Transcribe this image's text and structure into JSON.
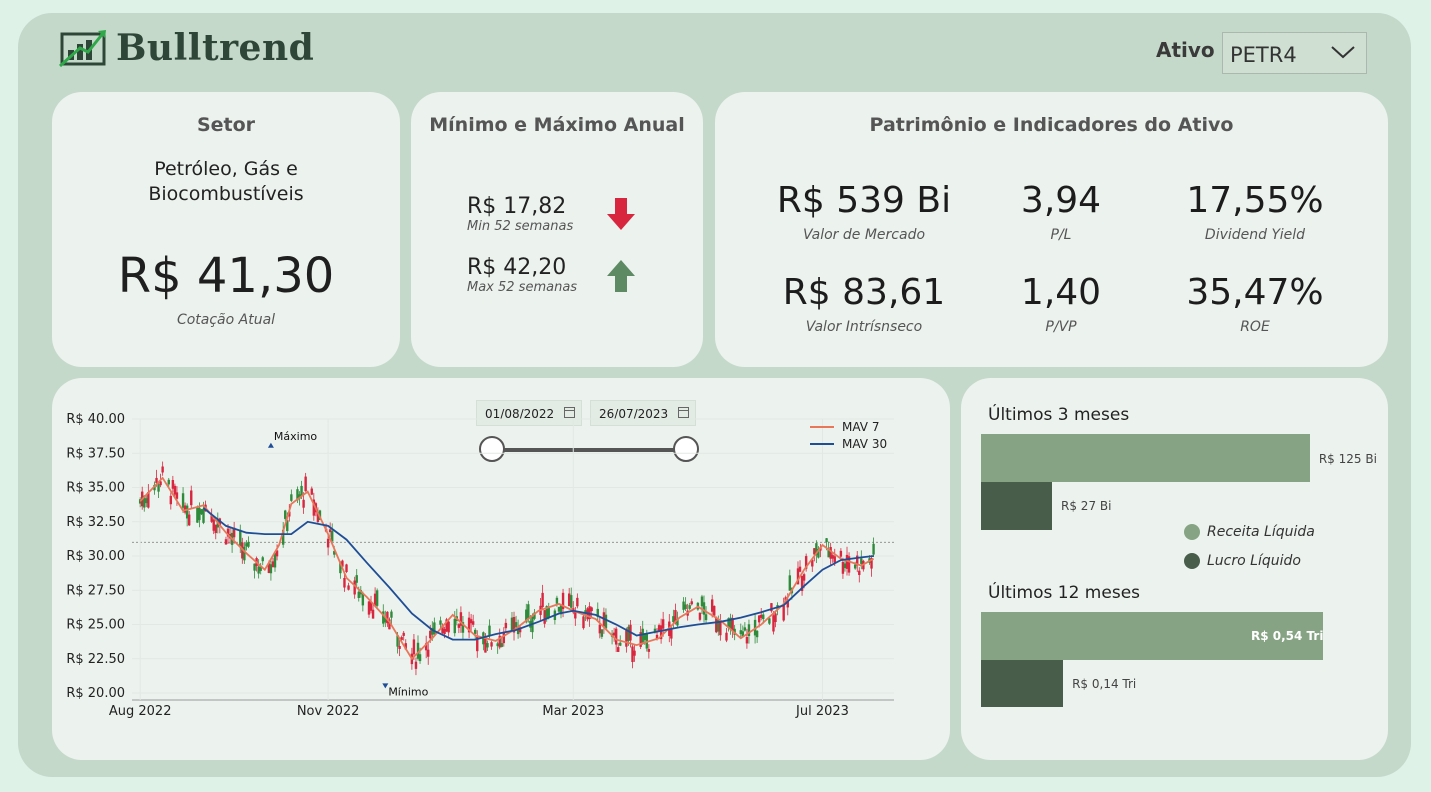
{
  "app": {
    "brand": "Bulltrend"
  },
  "asset_filter": {
    "label": "Ativo",
    "selected": "PETR4"
  },
  "sector_card": {
    "title": "Setor",
    "sector_line1": "Petróleo, Gás e",
    "sector_line2": "Biocombustíveis",
    "price": "R$ 41,30",
    "price_caption": "Cotação Atual"
  },
  "minmax_card": {
    "title": "Mínimo e Máximo Anual",
    "min_value": "R$ 17,82",
    "min_caption": "Min 52 semanas",
    "max_value": "R$ 42,20",
    "max_caption": "Max 52 semanas",
    "down_color": "#d8263f",
    "up_color": "#5e8a63"
  },
  "indicators_card": {
    "title": "Patrimônio e Indicadores do Ativo",
    "items": [
      {
        "value": "R$ 539 Bi",
        "caption": "Valor de Mercado"
      },
      {
        "value": "3,94",
        "caption": "P/L"
      },
      {
        "value": "17,55%",
        "caption": "Dividend Yield"
      },
      {
        "value": "R$ 83,61",
        "caption": "Valor Intrísnseco"
      },
      {
        "value": "1,40",
        "caption": "P/VP"
      },
      {
        "value": "35,47%",
        "caption": "ROE"
      }
    ]
  },
  "date_range": {
    "start": "01/08/2022",
    "end": "26/07/2023"
  },
  "chart_data": [
    {
      "type": "candlestick",
      "title": "",
      "y_ticks": [
        "R$ 40.00",
        "R$ 37.50",
        "R$ 35.00",
        "R$ 32.50",
        "R$ 30.00",
        "R$ 27.50",
        "R$ 25.00",
        "R$ 22.50",
        "R$ 20.00"
      ],
      "ylim": [
        20,
        40
      ],
      "x_ticks": [
        "Aug 2022",
        "Nov 2022",
        "Mar 2023",
        "Jul 2023"
      ],
      "reference_line": 31.0,
      "annotations": [
        {
          "text": "Máximo",
          "x": "2022-10-04",
          "y": 37.9
        },
        {
          "text": "Mínimo",
          "x": "2022-11-29",
          "y": 20.7
        }
      ],
      "legend": {
        "position": "top-right",
        "entries": [
          "MAV 7",
          "MAV 30"
        ]
      },
      "series": [
        {
          "name": "MAV 7",
          "color": "#e8775a",
          "x": [
            "2022-08-01",
            "2022-08-12",
            "2022-08-22",
            "2022-09-01",
            "2022-09-12",
            "2022-09-22",
            "2022-10-01",
            "2022-10-08",
            "2022-10-14",
            "2022-10-22",
            "2022-11-01",
            "2022-11-10",
            "2022-11-20",
            "2022-12-01",
            "2022-12-12",
            "2022-12-22",
            "2023-01-01",
            "2023-01-12",
            "2023-01-22",
            "2023-02-01",
            "2023-02-12",
            "2023-02-22",
            "2023-03-01",
            "2023-03-12",
            "2023-03-22",
            "2023-04-01",
            "2023-04-12",
            "2023-04-22",
            "2023-05-01",
            "2023-05-12",
            "2023-05-22",
            "2023-06-01",
            "2023-06-12",
            "2023-06-22",
            "2023-07-01",
            "2023-07-10",
            "2023-07-20",
            "2023-07-26"
          ],
          "y": [
            34.0,
            35.7,
            33.3,
            33.7,
            31.7,
            30.2,
            29.0,
            30.8,
            33.8,
            34.7,
            31.6,
            28.4,
            27.0,
            25.2,
            22.5,
            24.0,
            25.7,
            24.2,
            23.8,
            24.7,
            26.0,
            26.5,
            26.0,
            25.4,
            23.9,
            23.5,
            24.0,
            25.5,
            26.3,
            25.3,
            24.0,
            25.0,
            26.5,
            29.0,
            30.8,
            29.8,
            29.3,
            29.8
          ]
        },
        {
          "name": "MAV 30",
          "color": "#1f4e96",
          "x": [
            "2022-09-01",
            "2022-09-12",
            "2022-09-22",
            "2022-10-01",
            "2022-10-14",
            "2022-10-22",
            "2022-11-01",
            "2022-11-10",
            "2022-11-20",
            "2022-12-01",
            "2022-12-12",
            "2022-12-22",
            "2023-01-01",
            "2023-01-12",
            "2023-01-22",
            "2023-02-01",
            "2023-02-12",
            "2023-02-22",
            "2023-03-01",
            "2023-03-12",
            "2023-03-22",
            "2023-04-01",
            "2023-04-12",
            "2023-04-22",
            "2023-05-01",
            "2023-05-12",
            "2023-05-22",
            "2023-06-01",
            "2023-06-12",
            "2023-06-22",
            "2023-07-01",
            "2023-07-10",
            "2023-07-20",
            "2023-07-26"
          ],
          "y": [
            33.5,
            32.2,
            31.7,
            31.6,
            31.6,
            32.5,
            32.2,
            31.2,
            29.5,
            27.7,
            25.8,
            24.6,
            23.9,
            23.9,
            24.3,
            24.6,
            25.2,
            25.8,
            26.0,
            25.7,
            25.0,
            24.2,
            24.5,
            24.8,
            25.0,
            25.2,
            25.5,
            25.9,
            26.4,
            27.8,
            29.0,
            29.7,
            29.9,
            30.0
          ]
        }
      ]
    },
    {
      "type": "bar",
      "title": "Últimos 3 meses",
      "orientation": "horizontal",
      "series": [
        {
          "name": "Receita Líquida",
          "color": "#86a483",
          "value": 125,
          "label": "R$ 125 Bi"
        },
        {
          "name": "Lucro Líquido",
          "color": "#485e4a",
          "value": 27,
          "label": "R$ 27 Bi"
        }
      ]
    },
    {
      "type": "bar",
      "title": "Últimos 12 meses",
      "orientation": "horizontal",
      "series": [
        {
          "name": "Receita Líquida",
          "color": "#86a483",
          "value": 0.54,
          "label": "R$ 0,54 Tri"
        },
        {
          "name": "Lucro Líquido",
          "color": "#485e4a",
          "value": 0.14,
          "label": "R$ 0,14 Tri"
        }
      ]
    }
  ],
  "legend": {
    "revenue": "Receita Líquida",
    "profit": "Lucro Líquido"
  }
}
